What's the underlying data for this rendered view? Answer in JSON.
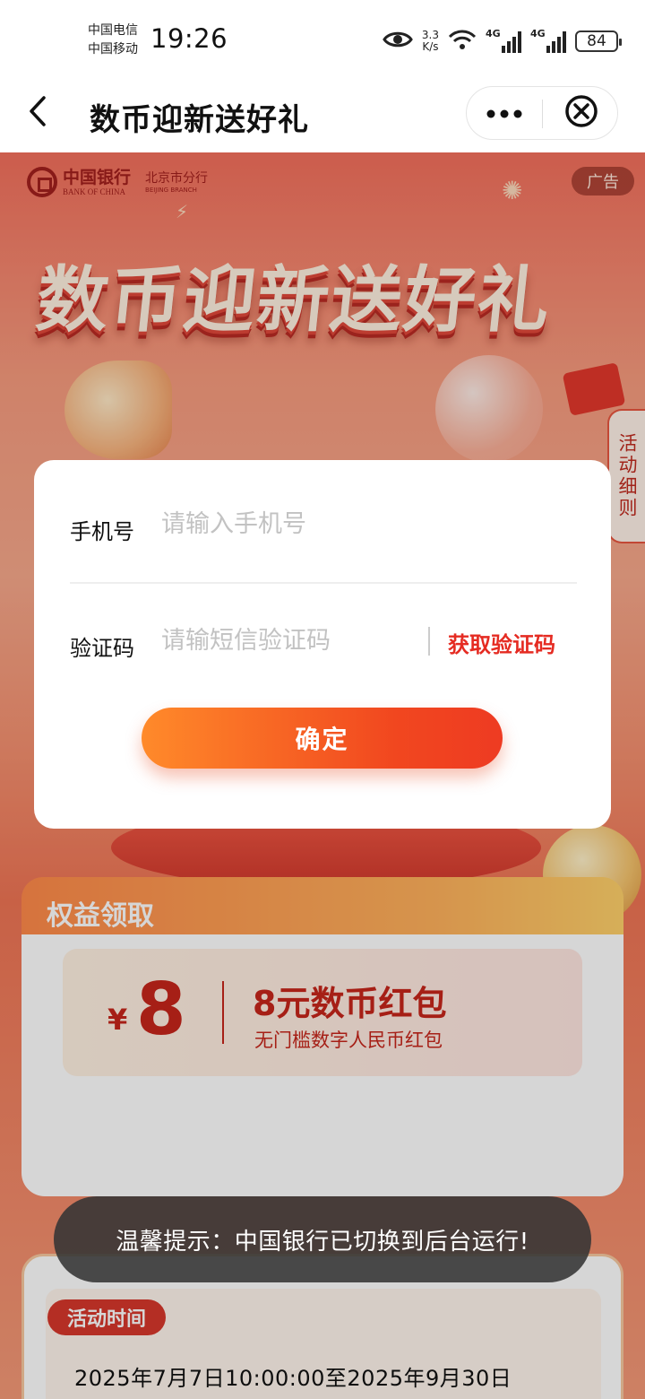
{
  "status_bar": {
    "carrier_1": "中国电信",
    "carrier_2": "中国移动",
    "time": "19:26",
    "net_speed_value": "3.3",
    "net_speed_unit": "K/s",
    "signal_1_label": "4G",
    "signal_2_label": "4G",
    "battery": "84",
    "icons": [
      "eye-icon",
      "wifi-icon",
      "signal-icon",
      "battery-icon"
    ]
  },
  "header": {
    "title": "数币迎新送好礼",
    "back_icon": "chevron-left-icon",
    "more_icon": "more-dots-icon",
    "close_icon": "close-circle-icon"
  },
  "banner": {
    "bank_name_cn": "中国银行",
    "bank_name_en": "BANK OF CHINA",
    "branch_cn": "北京市分行",
    "branch_en": "BEIJING BRANCH",
    "ad_badge": "广告",
    "hero_title": "数币迎新送好礼",
    "side_tab": "活动细则"
  },
  "benefits": {
    "title": "权益领取",
    "coupon_currency": "¥",
    "coupon_amount": "8",
    "coupon_name": "8元数币红包",
    "coupon_desc": "无门槛数字人民币红包"
  },
  "rules": {
    "time_label": "活动时间",
    "time_text": "2025年7月7日10:00:00至2025年9月30日"
  },
  "modal": {
    "phone_label": "手机号",
    "phone_placeholder": "请输入手机号",
    "code_label": "验证码",
    "code_placeholder": "请输短信验证码",
    "get_code": "获取验证码",
    "confirm": "确定"
  },
  "toast": {
    "text": "温馨提示：中国银行已切换到后台运行!"
  },
  "colors": {
    "accent_red": "#e52b22",
    "button_gradient_start": "#ff8a2a",
    "button_gradient_end": "#ee3b22",
    "page_bg": "#f79b7e"
  }
}
